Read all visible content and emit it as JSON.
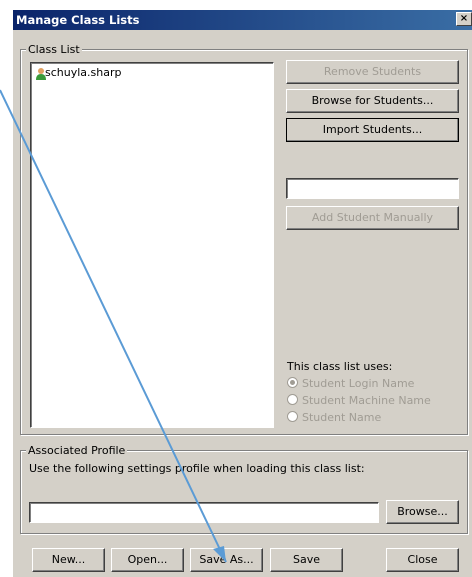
{
  "window": {
    "title": "Manage Class Lists",
    "close_glyph": "×"
  },
  "class_list": {
    "legend": "Class List",
    "students": [
      {
        "name": "schuyla.sharp",
        "icon": "user-icon"
      }
    ]
  },
  "actions": {
    "remove_students": "Remove Students",
    "browse_students": "Browse for Students...",
    "import_students": "Import Students...",
    "manual_input_value": "",
    "add_manually": "Add Student Manually"
  },
  "uses": {
    "heading": "This class list uses:",
    "options": [
      {
        "label": "Student Login Name",
        "selected": true
      },
      {
        "label": "Student Machine Name",
        "selected": false
      },
      {
        "label": "Student Name",
        "selected": false
      }
    ]
  },
  "profile": {
    "legend": "Associated Profile",
    "description": "Use the following settings profile when loading this class list:",
    "path_value": "",
    "browse": "Browse..."
  },
  "footer": {
    "new": "New...",
    "open": "Open...",
    "save_as": "Save As...",
    "save": "Save",
    "close": "Close"
  },
  "annotation": {
    "color": "#5b9bd5"
  }
}
